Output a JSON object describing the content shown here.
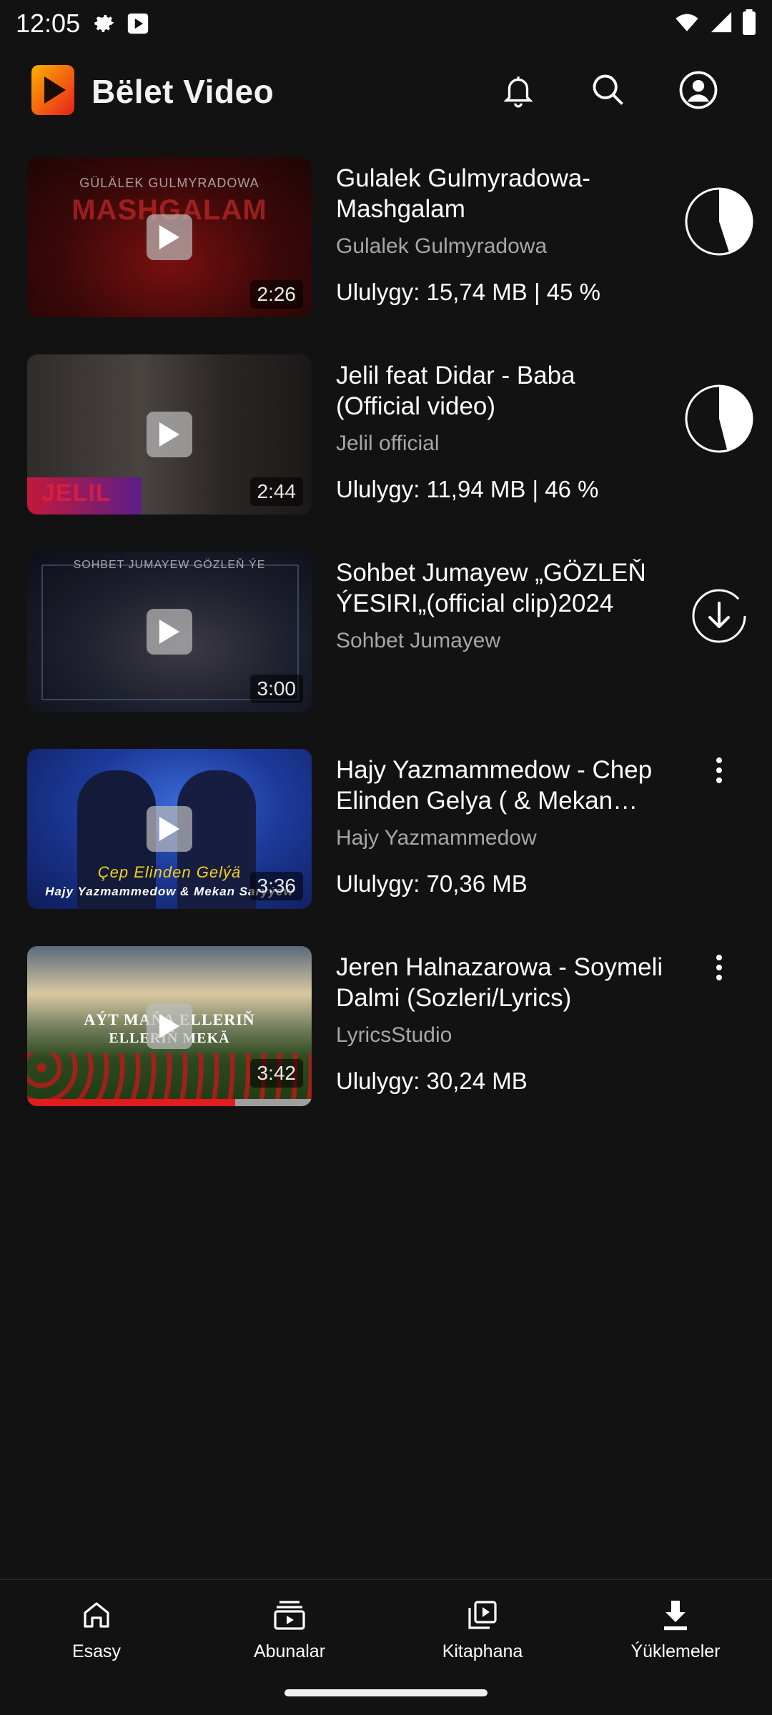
{
  "status_bar": {
    "time": "12:05"
  },
  "app": {
    "name": "Bëlet Video",
    "brand_color": "#ff5a1f"
  },
  "videos": [
    {
      "title": "Gulalek Gulmyradowa-Mashgalam",
      "channel": "Gulalek Gulmyradowa",
      "size": "Ululygy: 15,74 MB | 45 %",
      "duration": "2:26",
      "thumb_text": "GÜLÄLEK GULMYRADOWA",
      "thumb_text2": "MASHGALAM",
      "action": "download-progress",
      "progress": 0.45
    },
    {
      "title": "Jelil feat Didar - Baba (Official video)",
      "channel": "Jelil official",
      "size": "Ululygy: 11,94 MB | 46 %",
      "duration": "2:44",
      "thumb_text": "JELIL",
      "action": "download-progress",
      "progress": 0.46
    },
    {
      "title": "Sohbet Jumayew „GÖZLEŇ ÝESIRI„(official clip)2024",
      "channel": "Sohbet Jumayew",
      "size": "",
      "duration": "3:00",
      "thumb_text": "SOHBET JUMAYEW GÖZLEŇ ÝE",
      "action": "download-pending"
    },
    {
      "title": "Hajy Yazmammedow - Chep Elinden Gelya ( & Mekan Saryyew )",
      "channel": "Hajy Yazmammedow",
      "size": "Ululygy: 70,36 MB",
      "duration": "3:36",
      "thumb_text": "Çep Elinden Gelýä",
      "thumb_text2": "Hajy Yazmammedow & Mekan Saryýew",
      "action": "more-menu"
    },
    {
      "title": "Jeren Halnazarowa - Soymeli Dalmi (Sozleri/Lyrics)",
      "channel": "LyricsStudio",
      "size": "Ululygy: 30,24 MB",
      "duration": "3:42",
      "thumb_text": "AÝT MAŇA ELLERIŇ",
      "thumb_text2": "ELLERIŇ MEKÄ",
      "action": "more-menu",
      "watched_fraction": 0.73
    }
  ],
  "bottom_nav": [
    {
      "label": "Esasy",
      "icon": "home-icon"
    },
    {
      "label": "Abunalar",
      "icon": "subscriptions-icon"
    },
    {
      "label": "Kitaphana",
      "icon": "library-icon"
    },
    {
      "label": "Ýüklemeler",
      "icon": "downloads-icon",
      "active": true
    }
  ]
}
